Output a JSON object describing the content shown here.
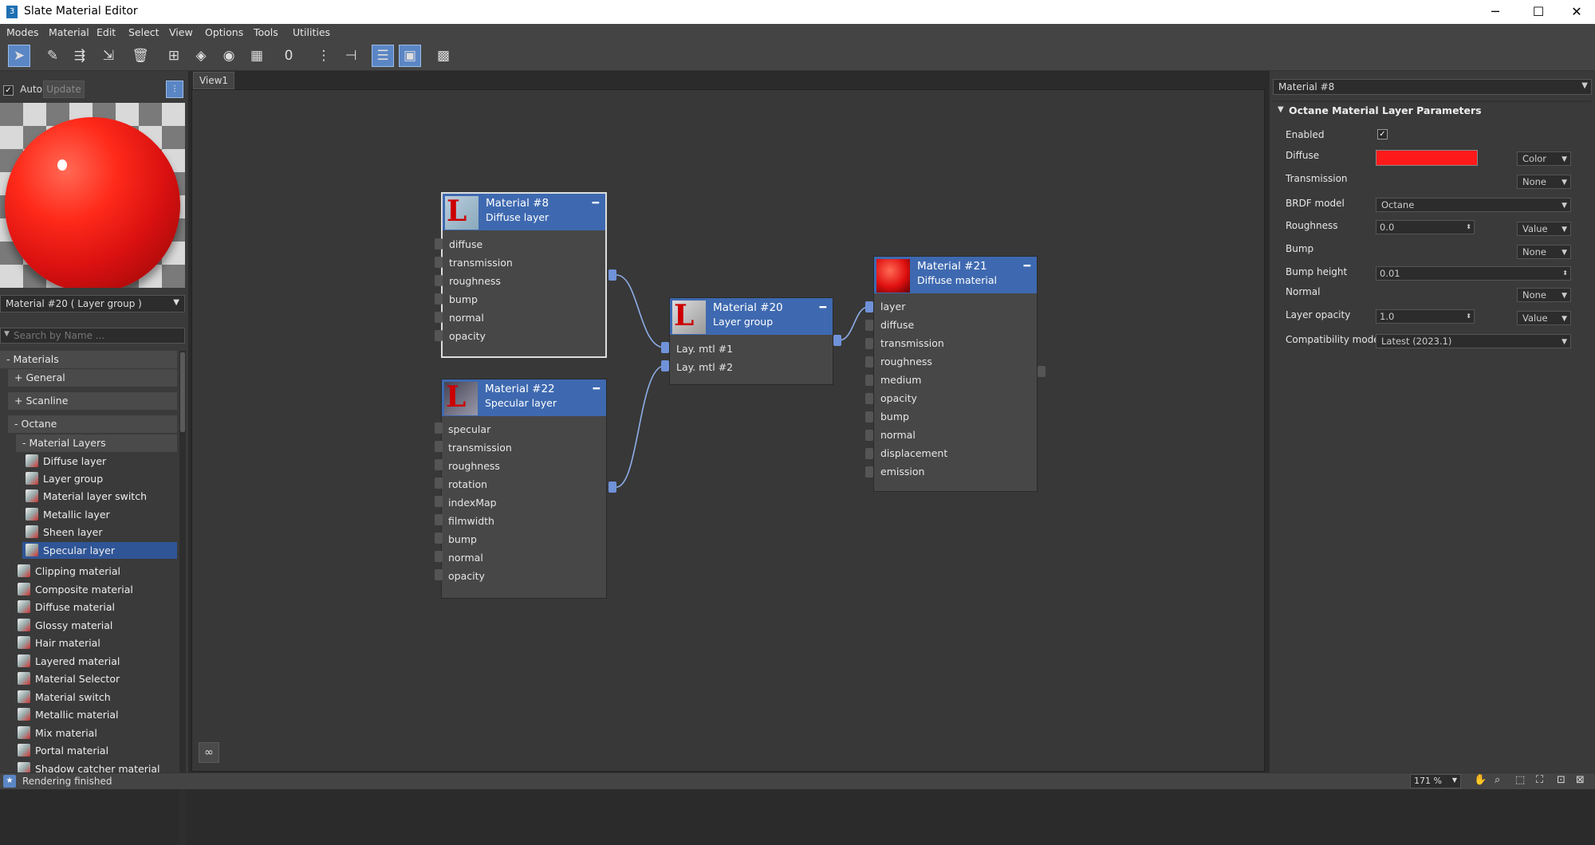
{
  "window": {
    "title": "Slate Material Editor",
    "app_icon": "3"
  },
  "menu": [
    "Modes",
    "Material",
    "Edit",
    "Select",
    "View",
    "Options",
    "Tools",
    "Utilities"
  ],
  "left": {
    "auto_label": "Auto",
    "update_label": "Update",
    "material_dropdown": "Material #20  ( Layer group )",
    "search_placeholder": "Search by Name ...",
    "tree": {
      "materials": "- Materials",
      "general": "+ General",
      "scanline": "+ Scanline",
      "octane": "- Octane",
      "material_layers": "- Material Layers",
      "layer_items": [
        "Diffuse layer",
        "Layer group",
        "Material layer switch",
        "Metallic layer",
        "Sheen layer",
        "Specular layer"
      ],
      "octane_items": [
        "Clipping material",
        "Composite material",
        "Diffuse material",
        "Glossy material",
        "Hair material",
        "Layered material",
        "Material Selector",
        "Material switch",
        "Metallic material",
        "Mix material",
        "Portal material",
        "Shadow catcher material"
      ]
    }
  },
  "view": {
    "tab": "View1",
    "nodes": {
      "n8": {
        "title": "Material #8",
        "sub": "Diffuse layer",
        "slots": [
          "diffuse",
          "transmission",
          "roughness",
          "bump",
          "normal",
          "opacity"
        ]
      },
      "n22": {
        "title": "Material #22",
        "sub": "Specular layer",
        "slots": [
          "specular",
          "transmission",
          "roughness",
          "rotation",
          "indexMap",
          "filmwidth",
          "bump",
          "normal",
          "opacity"
        ]
      },
      "n20": {
        "title": "Material #20",
        "sub": "Layer group",
        "slots": [
          "Lay. mtl #1",
          "Lay. mtl #2"
        ]
      },
      "n21": {
        "title": "Material #21",
        "sub": "Diffuse material",
        "slots": [
          "layer",
          "diffuse",
          "transmission",
          "roughness",
          "medium",
          "opacity",
          "bump",
          "normal",
          "displacement",
          "emission"
        ]
      }
    }
  },
  "params": {
    "header": "Material #8",
    "rollout": "Octane Material Layer Parameters",
    "enabled_label": "Enabled",
    "diffuse_label": "Diffuse",
    "diffuse_color": "#ff1a1a",
    "diffuse_mode": "Color",
    "transmission_label": "Transmission",
    "transmission_mode": "None",
    "brdf_label": "BRDF model",
    "brdf_value": "Octane",
    "roughness_label": "Roughness",
    "roughness_value": "0.0",
    "roughness_mode": "Value",
    "bump_label": "Bump",
    "bump_mode": "None",
    "bump_height_label": "Bump height",
    "bump_height_value": "0.01",
    "normal_label": "Normal",
    "normal_mode": "None",
    "layer_opacity_label": "Layer opacity",
    "layer_opacity_value": "1.0",
    "layer_opacity_mode": "Value",
    "compat_label": "Compatibility mode",
    "compat_value": "Latest (2023.1)"
  },
  "status": {
    "text": "Rendering finished",
    "zoom": "171 %"
  }
}
